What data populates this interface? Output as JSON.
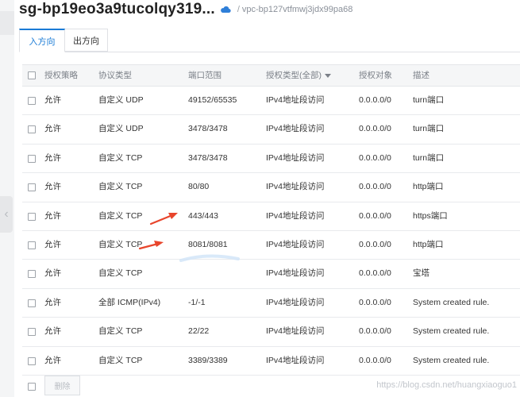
{
  "header": {
    "title": "sg-bp19eo3a9tucolqy319...",
    "vpc_separator": "/",
    "vpc_id": "vpc-bp127vtfmwj3jdx99pa68"
  },
  "tabs": [
    {
      "label": "入方向",
      "active": true
    },
    {
      "label": "出方向",
      "active": false
    }
  ],
  "table": {
    "columns": {
      "policy": "授权策略",
      "protocol": "协议类型",
      "port": "端口范围",
      "auth_type": "授权类型(全部)",
      "object": "授权对象",
      "desc": "描述"
    },
    "rows": [
      {
        "policy": "允许",
        "protocol": "自定义 UDP",
        "port": "49152/65535",
        "auth_type": "IPv4地址段访问",
        "object": "0.0.0.0/0",
        "desc": "turn端口"
      },
      {
        "policy": "允许",
        "protocol": "自定义 UDP",
        "port": "3478/3478",
        "auth_type": "IPv4地址段访问",
        "object": "0.0.0.0/0",
        "desc": "turn端口"
      },
      {
        "policy": "允许",
        "protocol": "自定义 TCP",
        "port": "3478/3478",
        "auth_type": "IPv4地址段访问",
        "object": "0.0.0.0/0",
        "desc": "turn端口"
      },
      {
        "policy": "允许",
        "protocol": "自定义 TCP",
        "port": "80/80",
        "auth_type": "IPv4地址段访问",
        "object": "0.0.0.0/0",
        "desc": "http端口"
      },
      {
        "policy": "允许",
        "protocol": "自定义 TCP",
        "port": "443/443",
        "auth_type": "IPv4地址段访问",
        "object": "0.0.0.0/0",
        "desc": "https端口"
      },
      {
        "policy": "允许",
        "protocol": "自定义 TCP",
        "port": "8081/8081",
        "auth_type": "IPv4地址段访问",
        "object": "0.0.0.0/0",
        "desc": "http端口"
      },
      {
        "policy": "允许",
        "protocol": "自定义 TCP",
        "port": "",
        "auth_type": "IPv4地址段访问",
        "object": "0.0.0.0/0",
        "desc": "宝塔"
      },
      {
        "policy": "允许",
        "protocol": "全部 ICMP(IPv4)",
        "port": "-1/-1",
        "auth_type": "IPv4地址段访问",
        "object": "0.0.0.0/0",
        "desc": "System created rule."
      },
      {
        "policy": "允许",
        "protocol": "自定义 TCP",
        "port": "22/22",
        "auth_type": "IPv4地址段访问",
        "object": "0.0.0.0/0",
        "desc": "System created rule."
      },
      {
        "policy": "允许",
        "protocol": "自定义 TCP",
        "port": "3389/3389",
        "auth_type": "IPv4地址段访问",
        "object": "0.0.0.0/0",
        "desc": "System created rule."
      }
    ]
  },
  "footer": {
    "delete_label": "删除",
    "watermark": "https://blog.csdn.net/huangxiaoguo1"
  },
  "icons": {
    "cloud": "cloud-icon",
    "collapse": "chevron-left-icon",
    "sort": "caret-down-icon"
  },
  "colors": {
    "accent": "#1a7bd6",
    "annotation_arrow": "#e8452c"
  }
}
